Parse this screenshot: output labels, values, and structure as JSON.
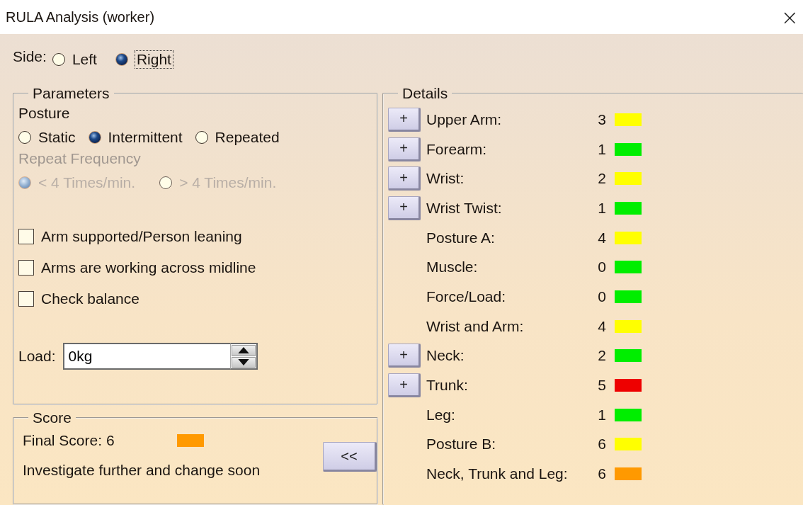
{
  "window": {
    "title": "RULA Analysis (worker)",
    "close": "×"
  },
  "side": {
    "label": "Side:",
    "options": [
      {
        "label": "Left",
        "selected": false,
        "focused": false
      },
      {
        "label": "Right",
        "selected": true,
        "focused": true
      }
    ]
  },
  "parameters": {
    "legend": "Parameters",
    "posture_label": "Posture",
    "posture": [
      {
        "label": "Static",
        "selected": false
      },
      {
        "label": "Intermittent",
        "selected": true
      },
      {
        "label": "Repeated",
        "selected": false
      }
    ],
    "frequency_label": "Repeat Frequency",
    "frequency_disabled": true,
    "frequency": [
      {
        "label": "< 4 Times/min.",
        "selected": true
      },
      {
        "label": "> 4 Times/min.",
        "selected": false
      }
    ],
    "checks": [
      {
        "label": "Arm supported/Person leaning",
        "checked": false
      },
      {
        "label": "Arms are working across midline",
        "checked": false
      },
      {
        "label": "Check balance",
        "checked": false
      }
    ],
    "load": {
      "label": "Load:",
      "value": "0kg"
    }
  },
  "score": {
    "legend": "Score",
    "final": "Final Score: 6",
    "color": "#ff9900",
    "message": "Investigate further and change soon",
    "collapse_button": "<<"
  },
  "details": {
    "legend": "Details",
    "rows": [
      {
        "button": "+",
        "label": "Upper Arm:",
        "value": "3",
        "color": "#ffff00"
      },
      {
        "button": "+",
        "label": "Forearm:",
        "value": "1",
        "color": "#00ee00"
      },
      {
        "button": "+",
        "label": "Wrist:",
        "value": "2",
        "color": "#ffff00"
      },
      {
        "button": "+",
        "label": "Wrist Twist:",
        "value": "1",
        "color": "#00ee00"
      },
      {
        "label": "Posture A:",
        "value": "4",
        "color": "#ffff00"
      },
      {
        "label": "Muscle:",
        "value": "0",
        "color": "#00ee00"
      },
      {
        "label": "Force/Load:",
        "value": "0",
        "color": "#00ee00"
      },
      {
        "label": "Wrist and Arm:",
        "value": "4",
        "color": "#ffff00"
      },
      {
        "button": "+",
        "label": "Neck:",
        "value": "2",
        "color": "#00ee00"
      },
      {
        "button": "+",
        "label": "Trunk:",
        "value": "5",
        "color": "#ee0000"
      },
      {
        "label": "Leg:",
        "value": "1",
        "color": "#00ee00"
      },
      {
        "label": "Posture B:",
        "value": "6",
        "color": "#ffff00"
      },
      {
        "label": "Neck, Trunk and Leg:",
        "value": "6",
        "color": "#ff9900"
      }
    ]
  }
}
